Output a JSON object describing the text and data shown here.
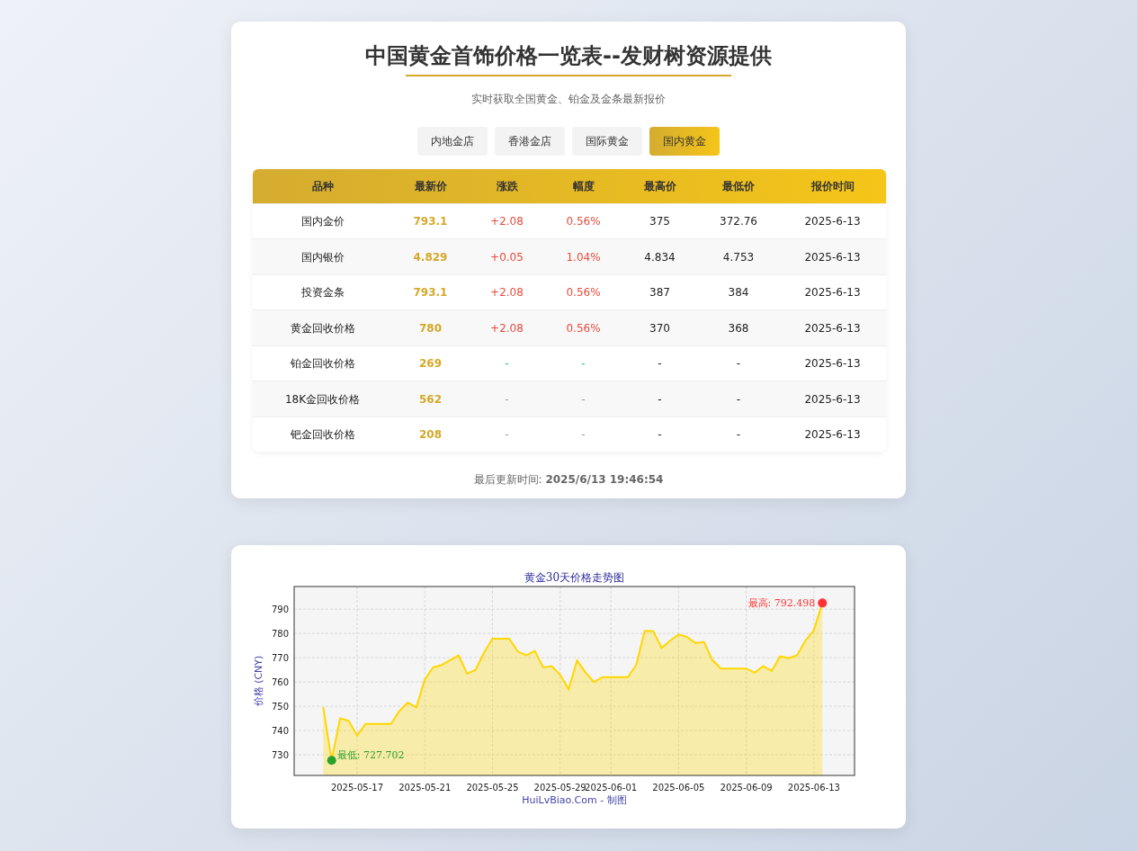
{
  "header": {
    "title": "中国黄金首饰价格一览表--发财树资源提供",
    "subtitle": "实时获取全国黄金、铂金及金条最新报价"
  },
  "tabs": [
    {
      "label": "内地金店",
      "selected": false
    },
    {
      "label": "香港金店",
      "selected": false
    },
    {
      "label": "国际黄金",
      "selected": false
    },
    {
      "label": "国内黄金",
      "selected": true
    }
  ],
  "table": {
    "columns": [
      "品种",
      "最新价",
      "涨跌",
      "幅度",
      "最高价",
      "最低价",
      "报价时间"
    ],
    "rows": [
      {
        "name": "国内金价",
        "price": "793.1",
        "change": "+2.08",
        "percent": "0.56%",
        "high": "375",
        "low": "372.76",
        "time": "2025-6-13",
        "color": "#e74c3c"
      },
      {
        "name": "国内银价",
        "price": "4.829",
        "change": "+0.05",
        "percent": "1.04%",
        "high": "4.834",
        "low": "4.753",
        "time": "2025-6-13",
        "color": "#e74c3c"
      },
      {
        "name": "投资金条",
        "price": "793.1",
        "change": "+2.08",
        "percent": "0.56%",
        "high": "387",
        "low": "384",
        "time": "2025-6-13",
        "color": "#e74c3c"
      },
      {
        "name": "黄金回收价格",
        "price": "780",
        "change": "+2.08",
        "percent": "0.56%",
        "high": "370",
        "low": "368",
        "time": "2025-6-13",
        "color": "#e74c3c"
      },
      {
        "name": "铂金回收价格",
        "price": "269",
        "change": "-",
        "percent": "-",
        "high": "-",
        "low": "-",
        "time": "2025-6-13",
        "color": "#1abc9c"
      },
      {
        "name": "18K金回收价格",
        "price": "562",
        "change": "-",
        "percent": "-",
        "high": "-",
        "low": "-",
        "time": "2025-6-13",
        "color": "#999999"
      },
      {
        "name": "钯金回收价格",
        "price": "208",
        "change": "-",
        "percent": "-",
        "high": "-",
        "low": "-",
        "time": "2025-6-13",
        "color": "#999999"
      }
    ]
  },
  "update": {
    "label": "最后更新时间:",
    "value": "2025/6/13 19:46:54"
  },
  "chart": {
    "credit": "HuiLvBiao.Com - 制图",
    "chart_data": {
      "type": "area",
      "title": "黄金30天价格走势图",
      "ylabel": "价格 (CNY)",
      "grid": true,
      "ylim": [
        721.5,
        799.3
      ],
      "categories": [
        null,
        null,
        null,
        null,
        "2025-05-17",
        null,
        null,
        null,
        null,
        null,
        null,
        null,
        "2025-05-21",
        null,
        null,
        null,
        null,
        null,
        null,
        null,
        "2025-05-25",
        null,
        null,
        null,
        null,
        null,
        null,
        null,
        "2025-05-29",
        null,
        null,
        null,
        null,
        null,
        "2025-06-01",
        null,
        null,
        null,
        null,
        null,
        null,
        null,
        "2025-06-05",
        null,
        null,
        null,
        null,
        null,
        null,
        null,
        "2025-06-09",
        null,
        null,
        null,
        null,
        null,
        null,
        null,
        "2025-06-13",
        null
      ],
      "yticks": [
        730,
        740,
        750,
        760,
        770,
        780,
        790
      ],
      "series": [
        {
          "color": "#ffd700",
          "values": [
            749.7,
            727.702,
            745,
            744,
            738,
            742.7,
            742.7,
            742.7,
            742.7,
            748,
            751.5,
            749.5,
            761,
            766,
            767,
            769,
            771,
            763.5,
            765,
            772,
            777.8,
            777.8,
            777.8,
            772.5,
            771,
            772.8,
            766,
            766.5,
            763,
            757,
            768.8,
            764,
            760,
            762,
            762,
            762,
            762,
            767,
            781,
            781,
            774,
            777,
            779.5,
            778.5,
            776,
            776.5,
            769,
            765.5,
            765.5,
            765.5,
            765.5,
            763.8,
            766.5,
            764.5,
            770.5,
            769.8,
            771,
            777,
            781.3,
            792.498
          ]
        }
      ],
      "annotations": [
        "最低: 727.702",
        "最高: 792.498"
      ]
    }
  }
}
